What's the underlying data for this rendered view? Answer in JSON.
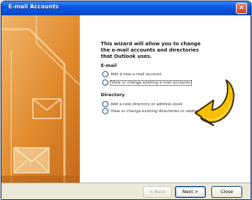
{
  "window": {
    "title": "E-mail Accounts",
    "close_glyph": "✕",
    "accent_color": "#0a4fd6",
    "art_color": "#e08a2e"
  },
  "wizard": {
    "intro": "This wizard will allow you to change the e-mail accounts and directories that Outlook uses.",
    "email_section": {
      "title": "E-mail",
      "options": [
        {
          "label": "Add a new e-mail account",
          "selected": false
        },
        {
          "label": "View or change existing e-mail accounts",
          "selected": true
        }
      ]
    },
    "directory_section": {
      "title": "Directory",
      "options": [
        {
          "label": "Add a new directory or address book",
          "selected": false
        },
        {
          "label": "View or change existing directories or address books",
          "selected": false
        }
      ]
    }
  },
  "buttons": {
    "back": "< Back",
    "next": "Next >",
    "close": "Close"
  },
  "annotation": {
    "pointer": "curved-arrow-icon",
    "color": "#f5c000"
  }
}
